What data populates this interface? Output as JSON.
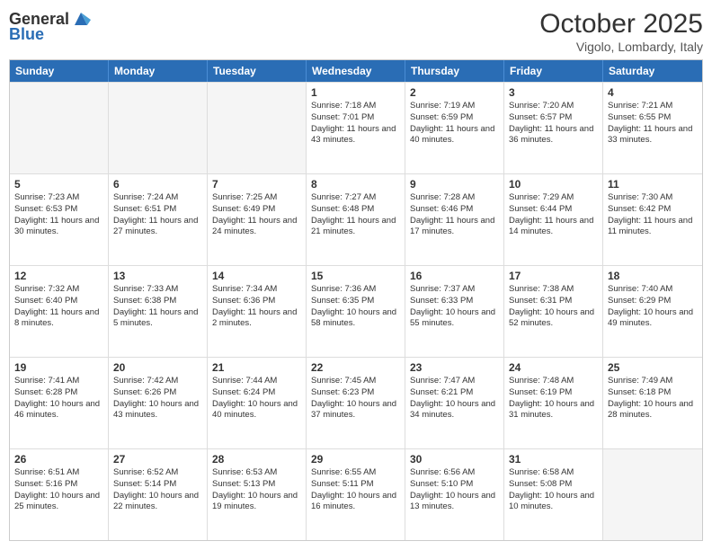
{
  "header": {
    "logo": {
      "general": "General",
      "blue": "Blue"
    },
    "title": "October 2025",
    "location": "Vigolo, Lombardy, Italy"
  },
  "calendar": {
    "days_of_week": [
      "Sunday",
      "Monday",
      "Tuesday",
      "Wednesday",
      "Thursday",
      "Friday",
      "Saturday"
    ],
    "weeks": [
      [
        {
          "day": "",
          "empty": true
        },
        {
          "day": "",
          "empty": true
        },
        {
          "day": "",
          "empty": true
        },
        {
          "day": "1",
          "sunrise": "7:18 AM",
          "sunset": "7:01 PM",
          "daylight": "11 hours and 43 minutes."
        },
        {
          "day": "2",
          "sunrise": "7:19 AM",
          "sunset": "6:59 PM",
          "daylight": "11 hours and 40 minutes."
        },
        {
          "day": "3",
          "sunrise": "7:20 AM",
          "sunset": "6:57 PM",
          "daylight": "11 hours and 36 minutes."
        },
        {
          "day": "4",
          "sunrise": "7:21 AM",
          "sunset": "6:55 PM",
          "daylight": "11 hours and 33 minutes."
        }
      ],
      [
        {
          "day": "5",
          "sunrise": "7:23 AM",
          "sunset": "6:53 PM",
          "daylight": "11 hours and 30 minutes."
        },
        {
          "day": "6",
          "sunrise": "7:24 AM",
          "sunset": "6:51 PM",
          "daylight": "11 hours and 27 minutes."
        },
        {
          "day": "7",
          "sunrise": "7:25 AM",
          "sunset": "6:49 PM",
          "daylight": "11 hours and 24 minutes."
        },
        {
          "day": "8",
          "sunrise": "7:27 AM",
          "sunset": "6:48 PM",
          "daylight": "11 hours and 21 minutes."
        },
        {
          "day": "9",
          "sunrise": "7:28 AM",
          "sunset": "6:46 PM",
          "daylight": "11 hours and 17 minutes."
        },
        {
          "day": "10",
          "sunrise": "7:29 AM",
          "sunset": "6:44 PM",
          "daylight": "11 hours and 14 minutes."
        },
        {
          "day": "11",
          "sunrise": "7:30 AM",
          "sunset": "6:42 PM",
          "daylight": "11 hours and 11 minutes."
        }
      ],
      [
        {
          "day": "12",
          "sunrise": "7:32 AM",
          "sunset": "6:40 PM",
          "daylight": "11 hours and 8 minutes."
        },
        {
          "day": "13",
          "sunrise": "7:33 AM",
          "sunset": "6:38 PM",
          "daylight": "11 hours and 5 minutes."
        },
        {
          "day": "14",
          "sunrise": "7:34 AM",
          "sunset": "6:36 PM",
          "daylight": "11 hours and 2 minutes."
        },
        {
          "day": "15",
          "sunrise": "7:36 AM",
          "sunset": "6:35 PM",
          "daylight": "10 hours and 58 minutes."
        },
        {
          "day": "16",
          "sunrise": "7:37 AM",
          "sunset": "6:33 PM",
          "daylight": "10 hours and 55 minutes."
        },
        {
          "day": "17",
          "sunrise": "7:38 AM",
          "sunset": "6:31 PM",
          "daylight": "10 hours and 52 minutes."
        },
        {
          "day": "18",
          "sunrise": "7:40 AM",
          "sunset": "6:29 PM",
          "daylight": "10 hours and 49 minutes."
        }
      ],
      [
        {
          "day": "19",
          "sunrise": "7:41 AM",
          "sunset": "6:28 PM",
          "daylight": "10 hours and 46 minutes."
        },
        {
          "day": "20",
          "sunrise": "7:42 AM",
          "sunset": "6:26 PM",
          "daylight": "10 hours and 43 minutes."
        },
        {
          "day": "21",
          "sunrise": "7:44 AM",
          "sunset": "6:24 PM",
          "daylight": "10 hours and 40 minutes."
        },
        {
          "day": "22",
          "sunrise": "7:45 AM",
          "sunset": "6:23 PM",
          "daylight": "10 hours and 37 minutes."
        },
        {
          "day": "23",
          "sunrise": "7:47 AM",
          "sunset": "6:21 PM",
          "daylight": "10 hours and 34 minutes."
        },
        {
          "day": "24",
          "sunrise": "7:48 AM",
          "sunset": "6:19 PM",
          "daylight": "10 hours and 31 minutes."
        },
        {
          "day": "25",
          "sunrise": "7:49 AM",
          "sunset": "6:18 PM",
          "daylight": "10 hours and 28 minutes."
        }
      ],
      [
        {
          "day": "26",
          "sunrise": "6:51 AM",
          "sunset": "5:16 PM",
          "daylight": "10 hours and 25 minutes."
        },
        {
          "day": "27",
          "sunrise": "6:52 AM",
          "sunset": "5:14 PM",
          "daylight": "10 hours and 22 minutes."
        },
        {
          "day": "28",
          "sunrise": "6:53 AM",
          "sunset": "5:13 PM",
          "daylight": "10 hours and 19 minutes."
        },
        {
          "day": "29",
          "sunrise": "6:55 AM",
          "sunset": "5:11 PM",
          "daylight": "10 hours and 16 minutes."
        },
        {
          "day": "30",
          "sunrise": "6:56 AM",
          "sunset": "5:10 PM",
          "daylight": "10 hours and 13 minutes."
        },
        {
          "day": "31",
          "sunrise": "6:58 AM",
          "sunset": "5:08 PM",
          "daylight": "10 hours and 10 minutes."
        },
        {
          "day": "",
          "empty": true
        }
      ]
    ]
  }
}
